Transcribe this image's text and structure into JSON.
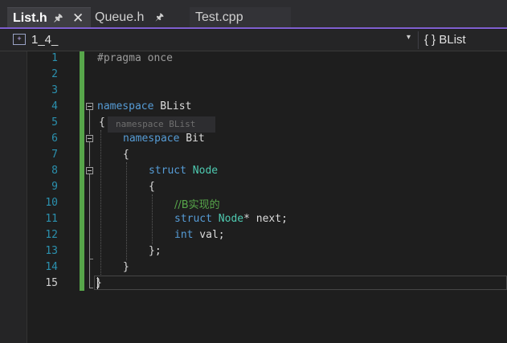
{
  "tabs": [
    {
      "label": "List.h",
      "active": true
    },
    {
      "label": "Queue.h",
      "active": false
    },
    {
      "label": "Test.cpp",
      "active": false
    }
  ],
  "tab_icons": {
    "pin": "📌",
    "close": "✕"
  },
  "navbar": {
    "project": "1_4_",
    "scope": "{ } BList",
    "dropdown": "▾"
  },
  "line_numbers": [
    "1",
    "2",
    "3",
    "4",
    "5",
    "6",
    "7",
    "8",
    "9",
    "10",
    "11",
    "12",
    "13",
    "14",
    "15"
  ],
  "code": {
    "l1": "#pragma once",
    "l4_kw": "namespace",
    "l4_name": " BList",
    "l5": "{",
    "peek": "namespace BList",
    "l6_kw": "namespace",
    "l6_name": " Bit",
    "l7": "{",
    "l8_kw": "struct",
    "l8_type": " Node",
    "l9": "{",
    "l10": "//B实现的",
    "l11_kw": "struct",
    "l11_type": " Node",
    "l11_rest": "* next;",
    "l12_kw": "int",
    "l12_rest": " val;",
    "l13": "};",
    "l14": "}",
    "l15": "}"
  },
  "colors": {
    "accent": "#7f5fd0",
    "keyword": "#569cd6",
    "type": "#4ec9b0",
    "comment": "#57a64a",
    "line_number": "#2b91af",
    "change_bar": "#57a64a"
  }
}
